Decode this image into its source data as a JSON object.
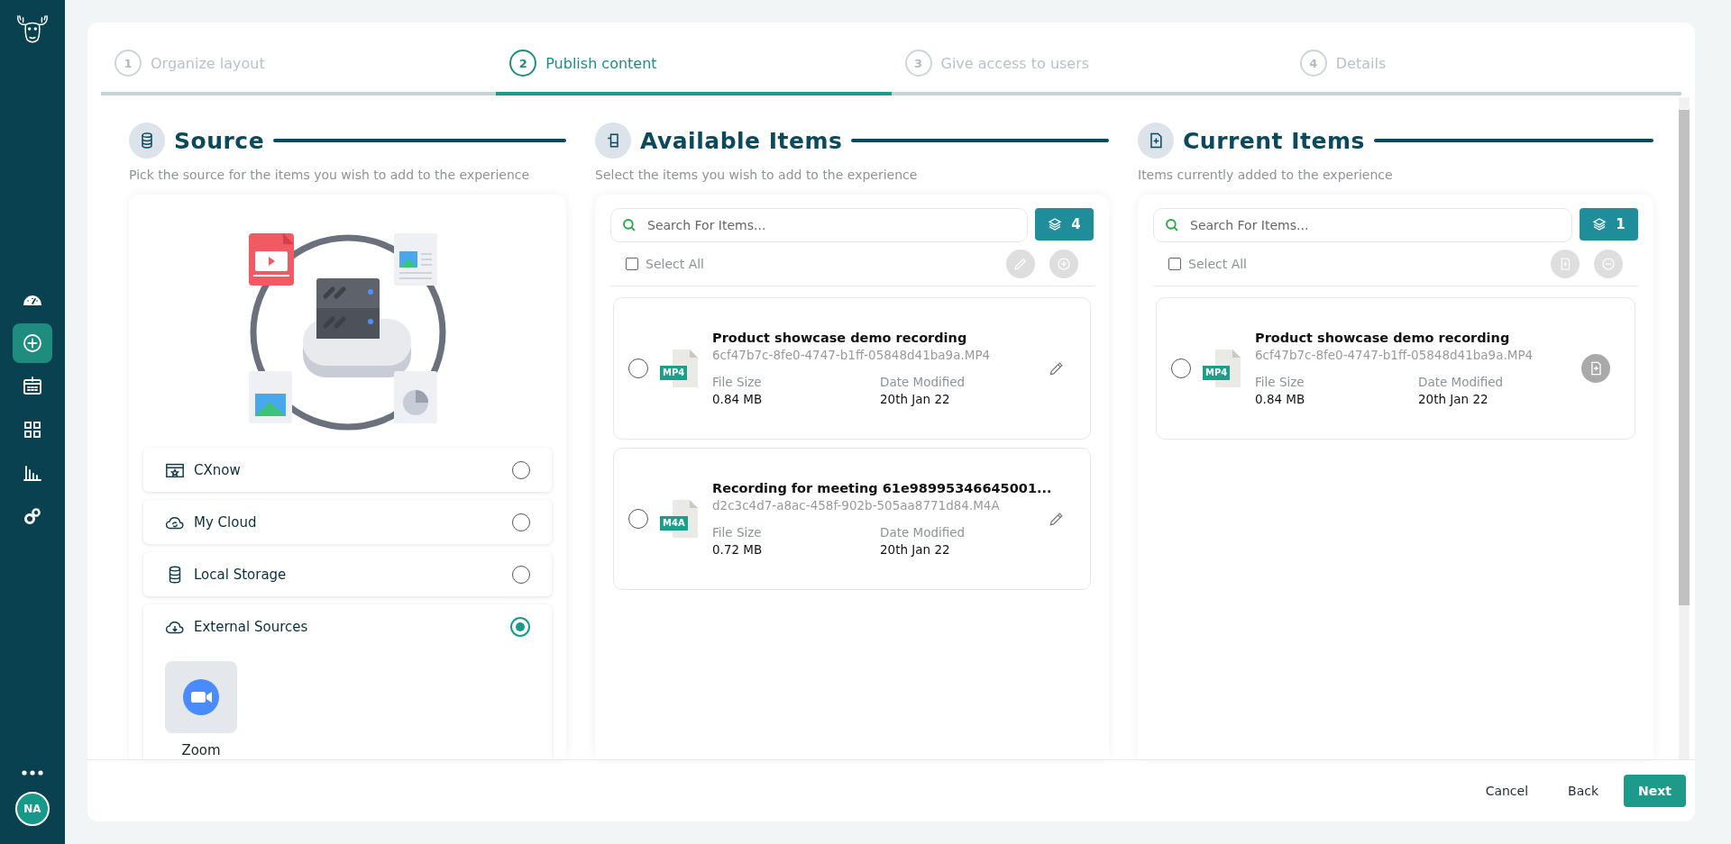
{
  "sidebar": {
    "nav": [
      {
        "kind": "dashboard",
        "selected": false
      },
      {
        "kind": "add",
        "selected": true
      },
      {
        "kind": "calendar",
        "selected": false
      },
      {
        "kind": "grid",
        "selected": false
      },
      {
        "kind": "chart",
        "selected": false
      },
      {
        "kind": "gears",
        "selected": false
      }
    ],
    "avatar": "NA"
  },
  "steps": [
    {
      "number": "1",
      "label": "Organize layout",
      "selected": false
    },
    {
      "number": "2",
      "label": "Publish content",
      "selected": true
    },
    {
      "number": "3",
      "label": "Give access to users",
      "selected": false
    },
    {
      "number": "4",
      "label": "Details",
      "selected": false
    }
  ],
  "source": {
    "title": "Source",
    "subtitle": "Pick the source for the items you wish to add to the experience",
    "options": [
      {
        "kind": "cxnow",
        "label": "CXnow",
        "selected": false
      },
      {
        "kind": "cloud",
        "label": "My Cloud",
        "selected": false
      },
      {
        "kind": "storage",
        "label": "Local Storage",
        "selected": false
      },
      {
        "kind": "external",
        "label": "External Sources",
        "selected": true,
        "integrations": [
          {
            "label": "Zoom"
          }
        ]
      }
    ]
  },
  "panels": [
    {
      "kind": "available",
      "title": "Available Items",
      "subtitle": "Select the items you wish to add to the experience",
      "search": {
        "placeholder": "Search For Items..."
      },
      "count": "4",
      "select_all": {
        "label": "Select All",
        "checked": false
      },
      "items": [
        {
          "title": "Product showcase demo recording",
          "filename": "6cf47b7c-8fe0-4747-b1ff-05848d41ba9a.MP4",
          "badge": "MP4",
          "size_label": "File Size",
          "size": "0.84 MB",
          "date_label": "Date Modified",
          "date": "20th Jan 22",
          "selected": false
        },
        {
          "title": "Recording for meeting 61e98995346645001...",
          "filename": "d2c3c4d7-a8ac-458f-902b-505aa8771d84.M4A",
          "badge": "M4A",
          "size_label": "File Size",
          "size": "0.72 MB",
          "date_label": "Date Modified",
          "date": "20th Jan 22",
          "selected": false
        }
      ]
    },
    {
      "kind": "current",
      "title": "Current Items",
      "subtitle": "Items currently added to the experience",
      "search": {
        "placeholder": "Search For Items..."
      },
      "count": "1",
      "select_all": {
        "label": "Select All",
        "checked": false
      },
      "items": [
        {
          "title": "Product showcase demo recording",
          "filename": "6cf47b7c-8fe0-4747-b1ff-05848d41ba9a.MP4",
          "badge": "MP4",
          "size_label": "File Size",
          "size": "0.84 MB",
          "date_label": "Date Modified",
          "date": "20th Jan 22",
          "selected": false
        }
      ]
    }
  ],
  "footer": {
    "buttons": [
      {
        "kind": "text",
        "label": "Cancel"
      },
      {
        "kind": "text",
        "label": "Back"
      },
      {
        "kind": "primary",
        "label": "Next"
      }
    ]
  }
}
